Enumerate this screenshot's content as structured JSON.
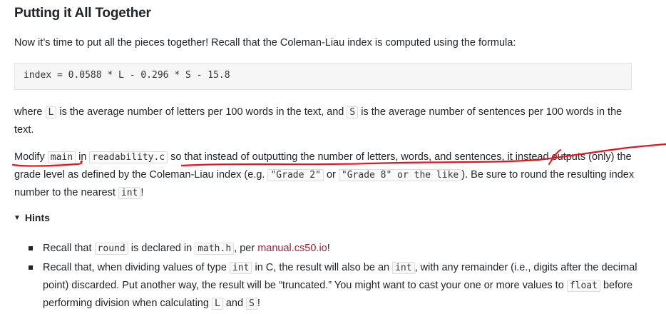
{
  "heading": "Putting it All Together",
  "intro": "Now it’s time to put all the pieces together! Recall that the Coleman-Liau index is computed using the formula:",
  "formula": "index = 0.0588 * L - 0.296 * S - 15.8",
  "where": {
    "t1": "where ",
    "c1": "L",
    "t2": " is the average number of letters per 100 words in the text, and ",
    "c2": "S",
    "t3": " is the average number of sentences per 100 words in the text."
  },
  "modify": {
    "t1": "Modify ",
    "c1": "main",
    "t2": " in ",
    "c2": "readability.c",
    "t3": " so that instead of outputting the number of letters, words, and sentences, it instead outputs (only) the grade level as defined by the Coleman-Liau index (e.g. ",
    "c3": "\"Grade 2\"",
    "t4": " or ",
    "c4": "\"Grade 8\" or the like",
    "t5": "). Be sure to round the resulting index number to the nearest ",
    "c5": "int",
    "t6": "!"
  },
  "hints": {
    "summary": "Hints",
    "items": [
      {
        "t1": "Recall that ",
        "c1": "round",
        "t2": " is declared in ",
        "c2": "math.h",
        "t3": ", per ",
        "link": "manual.cs50.io",
        "t4": "!"
      },
      {
        "t1": "Recall that, when dividing values of type ",
        "c1": "int",
        "t2": " in C, the result will also be an ",
        "c2": "int",
        "t3": ", with any remainder (i.e., digits after the decimal point) discarded. Put another way, the result will be “truncated.” You might want to cast your one or more values to ",
        "c3": "float",
        "t4": " before performing division when calculating ",
        "c4": "L",
        "t5": " and ",
        "c5": "S",
        "t6": "!"
      }
    ]
  },
  "annotation_color": "#e8141c"
}
